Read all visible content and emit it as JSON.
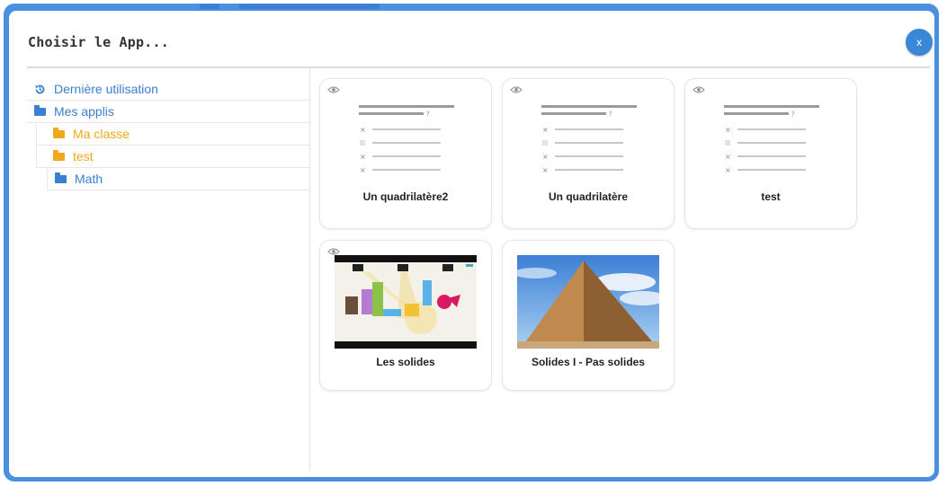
{
  "dialog": {
    "title": "Choisir le App...",
    "close_label": "x"
  },
  "tree": {
    "recent": "Dernière utilisation",
    "my_apps": "Mes applis",
    "folders": [
      "Ma classe",
      "test"
    ],
    "subfolder": "Math"
  },
  "cards": [
    {
      "label": "Un quadrilatère2",
      "type": "quiz"
    },
    {
      "label": "Un quadrilatère",
      "type": "quiz"
    },
    {
      "label": "test",
      "type": "quiz"
    },
    {
      "label": "Les solides",
      "type": "video"
    },
    {
      "label": "Solides I - Pas solides",
      "type": "image"
    }
  ],
  "colors": {
    "accent": "#3a7fd0",
    "folder_orange": "#f0a91c",
    "frame": "#4a8fe0"
  },
  "icons": {
    "recent": "history-icon",
    "folder": "folder-icon",
    "preview": "eye-icon"
  }
}
